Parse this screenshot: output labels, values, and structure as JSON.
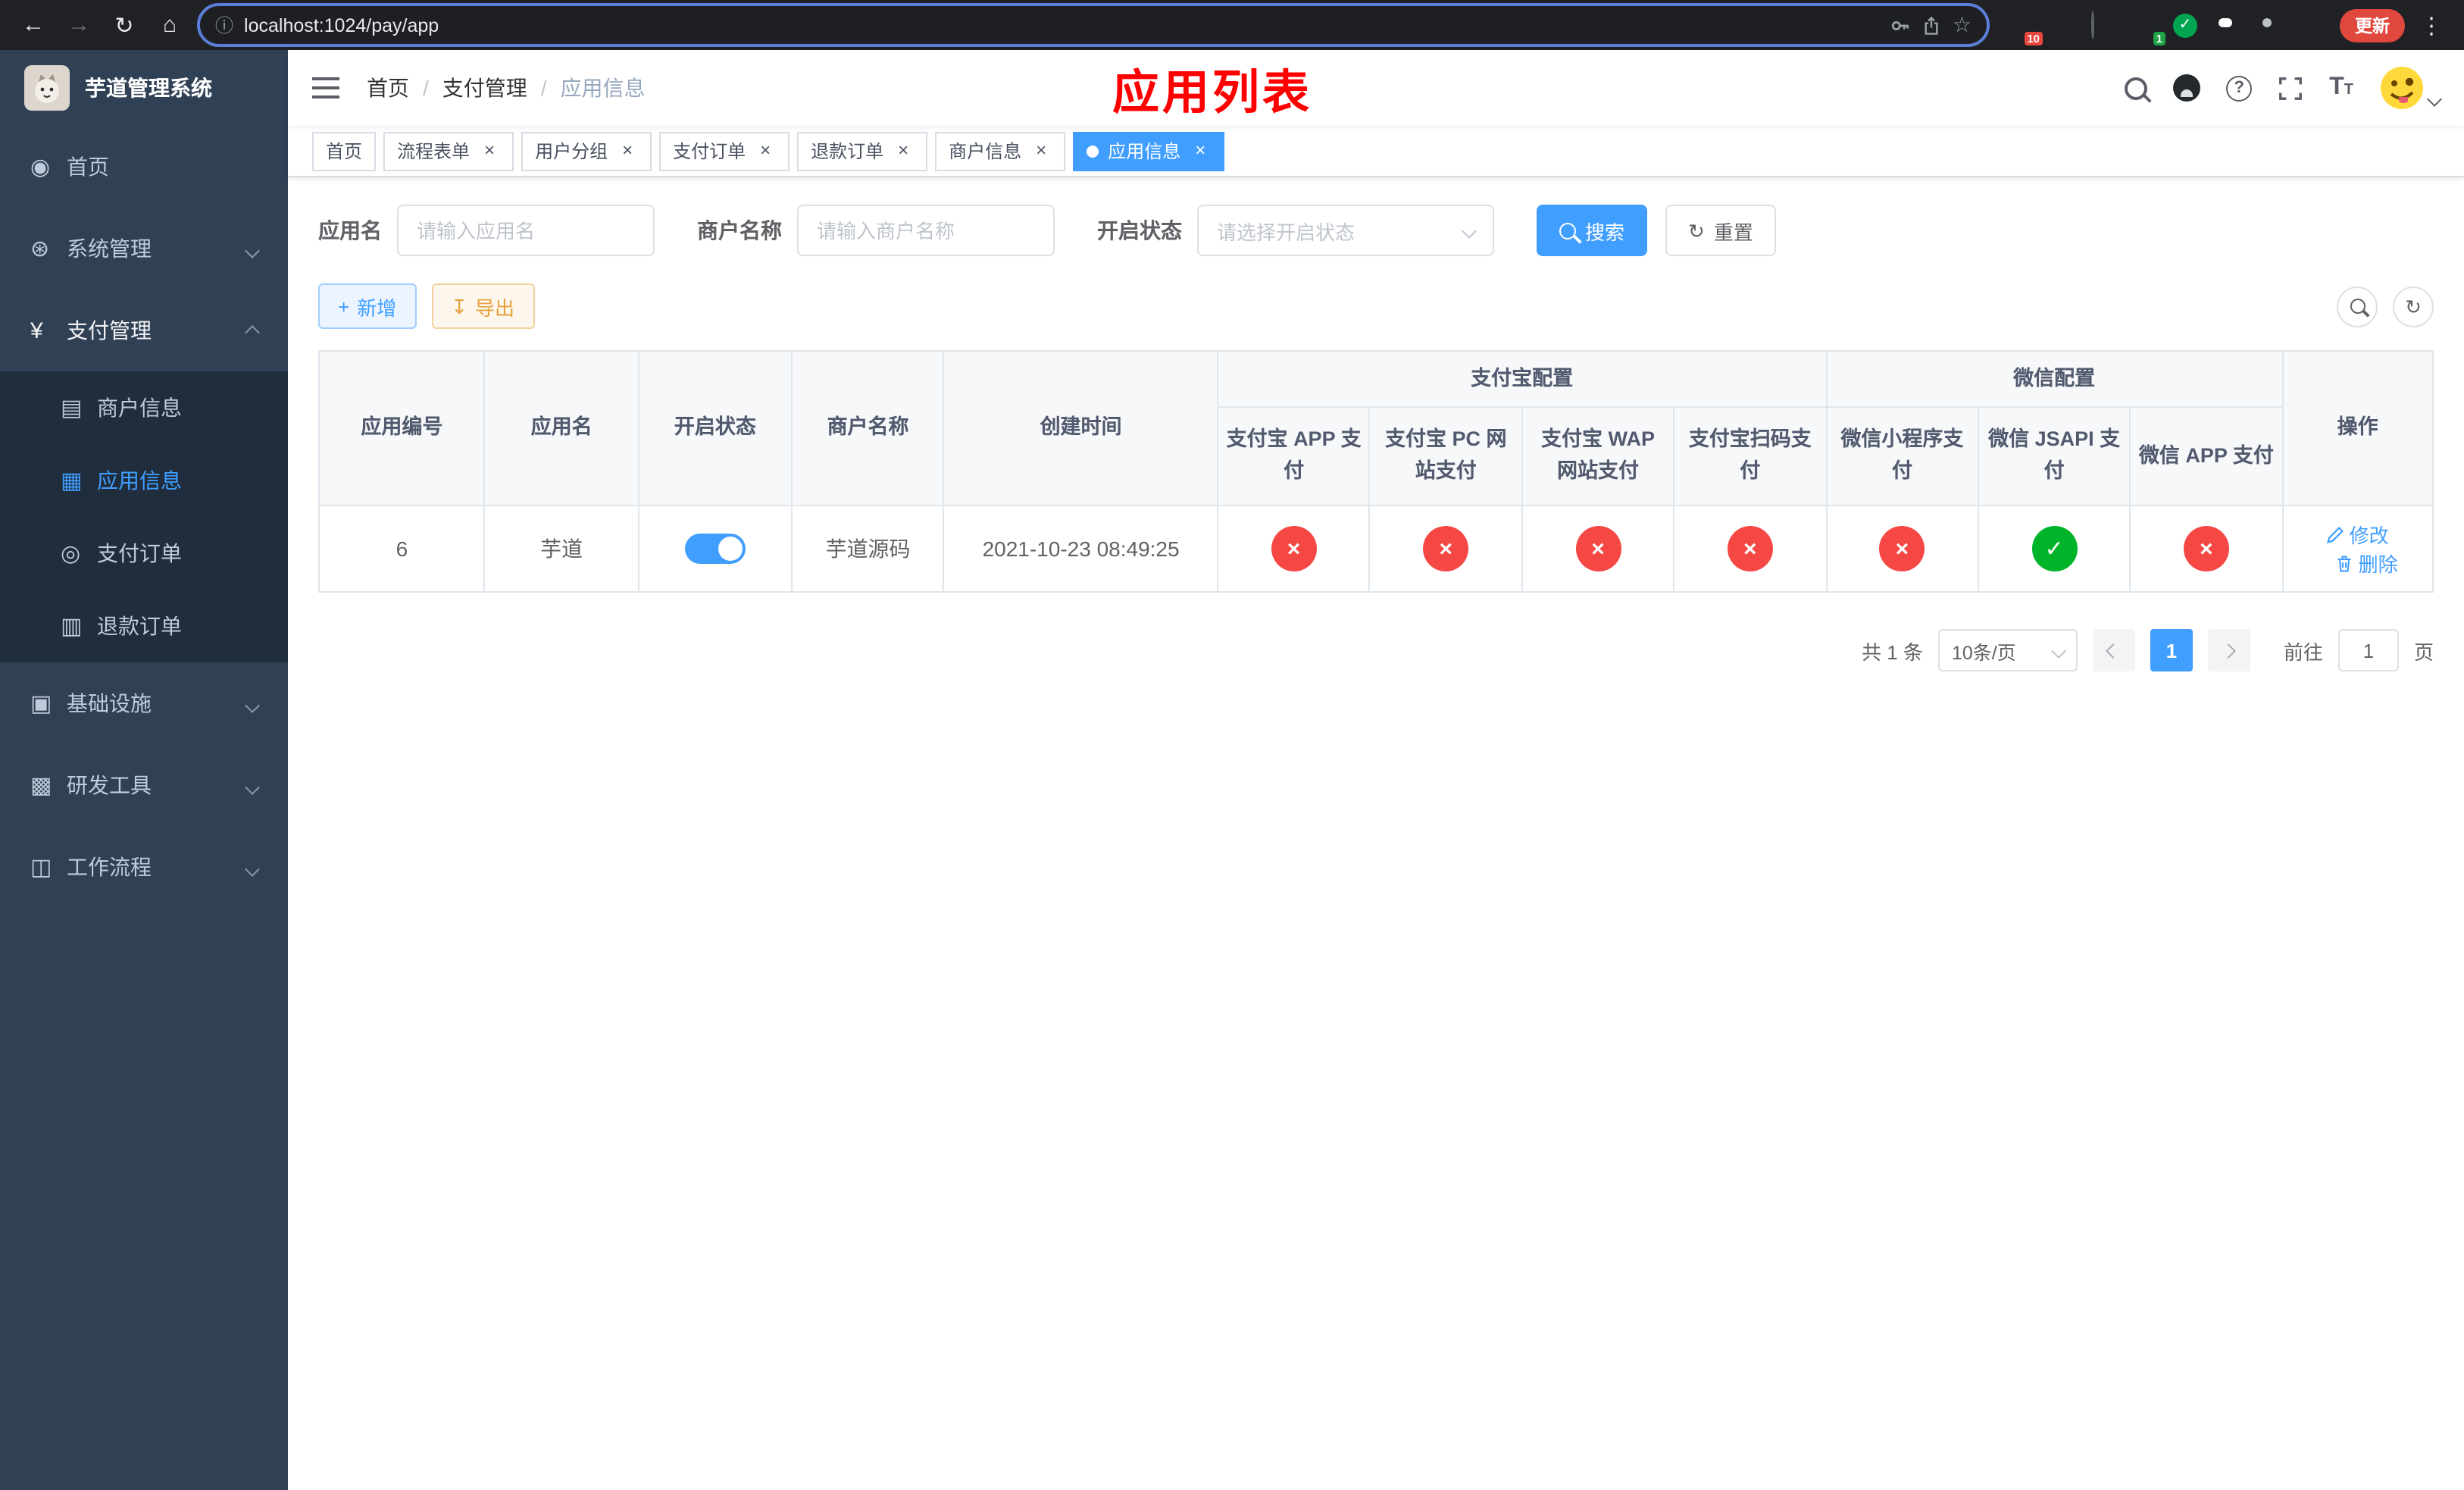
{
  "browser": {
    "url": "localhost:1024/pay/app",
    "update_label": "更新",
    "extension_badge_1": "10",
    "extension_badge_2": "1"
  },
  "icons": {
    "back": "←",
    "forward": "→",
    "reload": "↻",
    "home": "⌂",
    "info": "ⓘ",
    "star": "☆",
    "overflow": "⋮",
    "dashboard": "◉",
    "system": "⊛",
    "payment": "¥",
    "merchant": "▤",
    "app": "▦",
    "order": "◎",
    "refund": "▥",
    "infra": "▣",
    "tools": "▩",
    "workflow": "◫",
    "question": "?",
    "font": "T",
    "close": "×",
    "check": "✓",
    "cross": "×",
    "plus": "+",
    "download": "↧",
    "refresh": "↻"
  },
  "sidebar": {
    "app_title": "芋道管理系统",
    "menu": [
      {
        "label": "首页"
      },
      {
        "label": "系统管理"
      },
      {
        "label": "支付管理"
      },
      {
        "label": "基础设施"
      },
      {
        "label": "研发工具"
      },
      {
        "label": "工作流程"
      }
    ],
    "submenu": [
      {
        "label": "商户信息"
      },
      {
        "label": "应用信息"
      },
      {
        "label": "支付订单"
      },
      {
        "label": "退款订单"
      }
    ]
  },
  "header": {
    "breadcrumb": [
      {
        "label": "首页"
      },
      {
        "label": "支付管理"
      },
      {
        "label": "应用信息"
      }
    ],
    "annotation": "应用列表"
  },
  "tags": [
    {
      "label": "首页"
    },
    {
      "label": "流程表单"
    },
    {
      "label": "用户分组"
    },
    {
      "label": "支付订单"
    },
    {
      "label": "退款订单"
    },
    {
      "label": "商户信息"
    },
    {
      "label": "应用信息"
    }
  ],
  "filters": {
    "app_name_label": "应用名",
    "app_name_placeholder": "请输入应用名",
    "merchant_label": "商户名称",
    "merchant_placeholder": "请输入商户名称",
    "status_label": "开启状态",
    "status_placeholder": "请选择开启状态",
    "search_label": "搜索",
    "reset_label": "重置"
  },
  "toolbar": {
    "add_label": "新增",
    "export_label": "导出"
  },
  "table": {
    "group_headers": {
      "alipay": "支付宝配置",
      "wechat": "微信配置"
    },
    "columns": {
      "app_id": "应用编号",
      "app_name": "应用名",
      "status": "开启状态",
      "merchant": "商户名称",
      "created": "创建时间",
      "alipay_app": "支付宝 APP 支付",
      "alipay_pc": "支付宝 PC 网站支付",
      "alipay_wap": "支付宝 WAP 网站支付",
      "alipay_qr": "支付宝扫码支付",
      "wx_lite": "微信小程序支付",
      "wx_jsapi": "微信 JSAPI 支付",
      "wx_app": "微信 APP 支付",
      "actions": "操作"
    },
    "row": {
      "id": "6",
      "name": "芋道",
      "enabled": true,
      "merchant": "芋道源码",
      "created_at": "2021-10-23 08:49:25",
      "channels": [
        "cross",
        "cross",
        "cross",
        "cross",
        "cross",
        "check",
        "cross"
      ],
      "edit_label": "修改",
      "delete_label": "删除"
    }
  },
  "pagination": {
    "total_text": "共 1 条",
    "page_size_text": "10条/页",
    "current_page": "1",
    "goto_label": "前往",
    "goto_value": "1",
    "page_unit": "页"
  }
}
